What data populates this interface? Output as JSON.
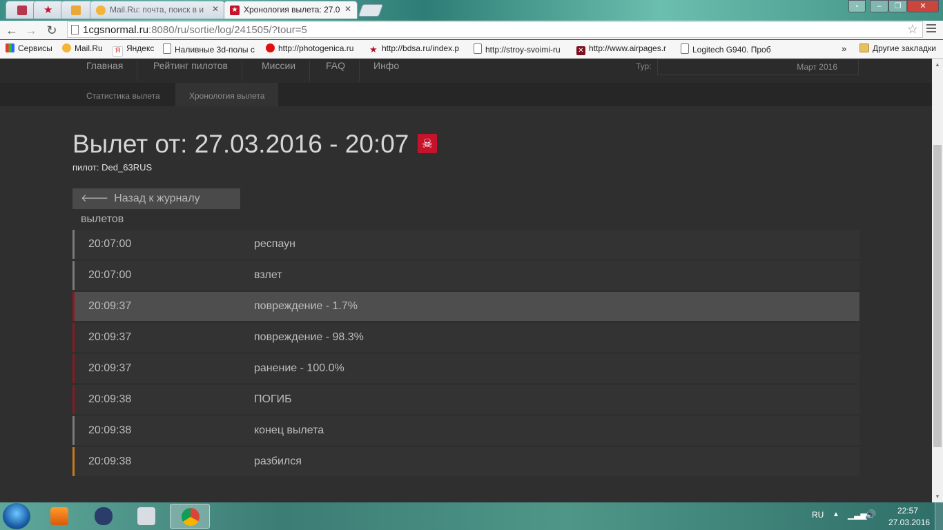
{
  "browser": {
    "tabs": [
      {
        "title": "",
        "active": false
      },
      {
        "title": "",
        "active": false
      },
      {
        "title": "",
        "active": false
      },
      {
        "title": "Mail.Ru: почта, поиск в и",
        "active": false
      },
      {
        "title": "Хронология вылета: 27.0",
        "active": true
      }
    ],
    "url_host": "1cgsnormal.ru",
    "url_rest": ":8080/ru/sortie/log/241505/?tour=5",
    "bookmarks": [
      "Сервисы",
      "Mail.Ru",
      "Яндекс",
      "Наливные 3d-полы с",
      "http://photogenica.ru",
      "http://bdsa.ru/index.p",
      "http://stroy-svoimi-ru",
      "http://www.airpages.r",
      "Logitech G940. Проб"
    ],
    "bookmarks_overflow": "»",
    "other_bookmarks": "Другие закладки"
  },
  "nav": {
    "items": [
      "Главная",
      "Рейтинг пилотов",
      "Миссии",
      "FAQ",
      "Инфо"
    ],
    "tour_label": "Тур:",
    "tour_value": "Март 2016"
  },
  "subnav": {
    "items": [
      "Статистика вылета",
      "Хронология вылета"
    ],
    "active_index": 1
  },
  "sortie": {
    "title": "Вылет от: 27.03.2016 - 20:07",
    "status_icon": "skull-crossbones-icon",
    "pilot": "пилот: Ded_63RUS",
    "back_button": "Назад к журналу вылетов"
  },
  "events": [
    {
      "time": "20:07:00",
      "text": "респаун",
      "color": "#7a7a7a"
    },
    {
      "time": "20:07:00",
      "text": "взлет",
      "color": "#7a7a7a"
    },
    {
      "time": "20:09:37",
      "text": "повреждение - 1.7%",
      "color": "#8b1a24"
    },
    {
      "time": "20:09:37",
      "text": "повреждение - 98.3%",
      "color": "#8b1a24"
    },
    {
      "time": "20:09:37",
      "text": "ранение - 100.0%",
      "color": "#8b1a24"
    },
    {
      "time": "20:09:38",
      "text": "ПОГИБ",
      "color": "#8b1a24"
    },
    {
      "time": "20:09:38",
      "text": "конец вылета",
      "color": "#7a7a7a"
    },
    {
      "time": "20:09:38",
      "text": "разбился",
      "color": "#c97a1e"
    }
  ],
  "taskbar": {
    "lang": "RU",
    "time": "22:57",
    "date": "27.03.2016"
  },
  "colors": {
    "accent_red": "#c5132c",
    "page_bg": "#2f2f2f"
  }
}
